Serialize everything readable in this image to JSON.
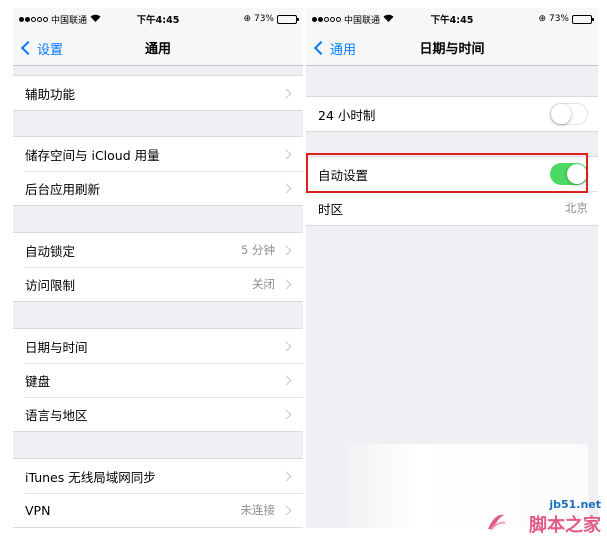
{
  "left": {
    "status": {
      "carrier": "中国联通",
      "time": "下午4:45",
      "battery": "73%",
      "battery_level": 0.73
    },
    "nav": {
      "back_label": "设置",
      "title": "通用"
    },
    "groups": [
      [
        {
          "label": "辅助功能",
          "value": ""
        }
      ],
      [
        {
          "label": "储存空间与 iCloud 用量",
          "value": ""
        },
        {
          "label": "后台应用刷新",
          "value": ""
        }
      ],
      [
        {
          "label": "自动锁定",
          "value": "5 分钟"
        },
        {
          "label": "访问限制",
          "value": "关闭"
        }
      ],
      [
        {
          "label": "日期与时间",
          "value": ""
        },
        {
          "label": "键盘",
          "value": ""
        },
        {
          "label": "语言与地区",
          "value": ""
        }
      ],
      [
        {
          "label": "iTunes 无线局域网同步",
          "value": ""
        },
        {
          "label": "VPN",
          "value": "未连接"
        }
      ]
    ]
  },
  "right": {
    "status": {
      "carrier": "中国联通",
      "time": "下午4:45",
      "battery": "73%",
      "battery_level": 0.73
    },
    "nav": {
      "back_label": "通用",
      "title": "日期与时间"
    },
    "hour24": {
      "label": "24 小时制",
      "on": false
    },
    "auto_set": {
      "label": "自动设置",
      "on": true
    },
    "timezone": {
      "label": "时区",
      "value": "北京"
    }
  },
  "colors": {
    "accent": "#007aff",
    "toggle_on": "#4cd964",
    "highlight": "#d9221b"
  },
  "watermark": {
    "line1": "jb51.net",
    "line2": "脚本之家"
  }
}
